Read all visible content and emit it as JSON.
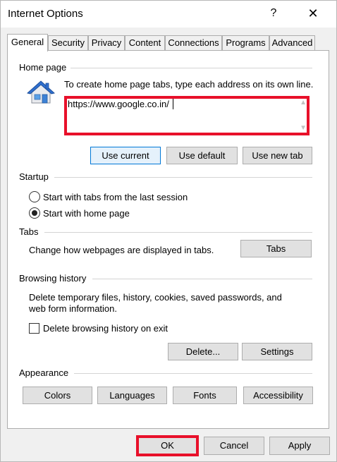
{
  "window": {
    "title": "Internet Options",
    "help_glyph": "?",
    "close_glyph": "✕"
  },
  "tabs": [
    {
      "label": "General",
      "active": true
    },
    {
      "label": "Security"
    },
    {
      "label": "Privacy"
    },
    {
      "label": "Content"
    },
    {
      "label": "Connections"
    },
    {
      "label": "Programs"
    },
    {
      "label": "Advanced"
    }
  ],
  "home_page": {
    "group_label": "Home page",
    "instructions": "To create home page tabs, type each address on its own line.",
    "value": "https://www.google.co.in/",
    "use_current": "Use current",
    "use_default": "Use default",
    "use_new_tab": "Use new tab"
  },
  "startup": {
    "group_label": "Startup",
    "option_last_session": "Start with tabs from the last session",
    "option_home_page": "Start with home page"
  },
  "tabs_group": {
    "group_label": "Tabs",
    "description": "Change how webpages are displayed in tabs.",
    "button": "Tabs"
  },
  "browsing_history": {
    "group_label": "Browsing history",
    "description_line1": "Delete temporary files, history, cookies, saved passwords, and",
    "description_line2": "web form information.",
    "delete_on_exit": "Delete browsing history on exit",
    "delete_button": "Delete...",
    "settings_button": "Settings"
  },
  "appearance": {
    "group_label": "Appearance",
    "colors": "Colors",
    "languages": "Languages",
    "fonts": "Fonts",
    "accessibility": "Accessibility"
  },
  "footer": {
    "ok": "OK",
    "cancel": "Cancel",
    "apply": "Apply"
  },
  "colors": {
    "highlight": "#e8102a",
    "focus_blue": "#0078d7"
  }
}
